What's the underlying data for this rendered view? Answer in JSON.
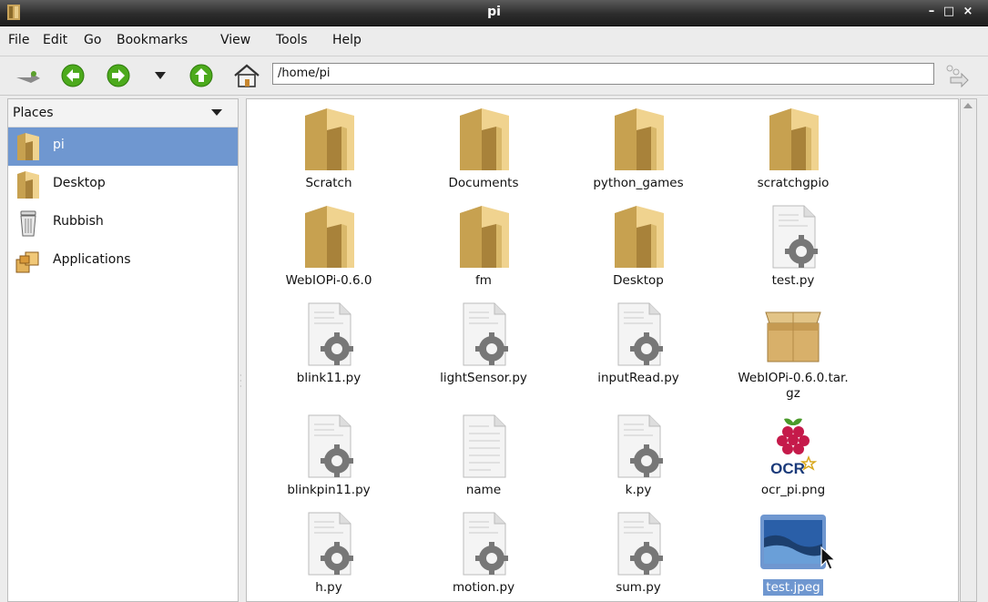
{
  "window": {
    "title": "pi",
    "minimize": "–",
    "maximize": "□",
    "close": "×"
  },
  "menu": [
    "File",
    "Edit",
    "Go",
    "Bookmarks",
    "View",
    "Tools",
    "Help"
  ],
  "toolbar": {
    "icons": [
      "new-tab-icon",
      "back-icon",
      "forward-icon",
      "history-dropdown-icon",
      "up-icon",
      "home-icon",
      "go-icon"
    ],
    "path": "/home/pi"
  },
  "sidebar": {
    "title": "Places",
    "items": [
      {
        "label": "pi",
        "icon": "home-folder-icon",
        "selected": true
      },
      {
        "label": "Desktop",
        "icon": "desktop-folder-icon",
        "selected": false
      },
      {
        "label": "Rubbish",
        "icon": "trash-icon",
        "selected": false
      },
      {
        "label": "Applications",
        "icon": "applications-icon",
        "selected": false
      }
    ]
  },
  "files": [
    {
      "name": "Scratch",
      "type": "folder"
    },
    {
      "name": "Documents",
      "type": "folder"
    },
    {
      "name": "python_games",
      "type": "folder"
    },
    {
      "name": "scratchgpio",
      "type": "folder"
    },
    {
      "name": "WebIOPi-0.6.0",
      "type": "folder"
    },
    {
      "name": "fm",
      "type": "folder"
    },
    {
      "name": "Desktop",
      "type": "folder"
    },
    {
      "name": "test.py",
      "type": "script"
    },
    {
      "name": "blink11.py",
      "type": "script"
    },
    {
      "name": "lightSensor.py",
      "type": "script"
    },
    {
      "name": "inputRead.py",
      "type": "script"
    },
    {
      "name": "WebIOPi-0.6.0.tar.\ngz",
      "type": "archive"
    },
    {
      "name": "blinkpin11.py",
      "type": "script"
    },
    {
      "name": "name",
      "type": "text"
    },
    {
      "name": "k.py",
      "type": "script"
    },
    {
      "name": "ocr_pi.png",
      "type": "logo-image",
      "logo_text": "OCR"
    },
    {
      "name": "h.py",
      "type": "script"
    },
    {
      "name": "motion.py",
      "type": "script"
    },
    {
      "name": "sum.py",
      "type": "script"
    },
    {
      "name": "test.jpeg",
      "type": "photo",
      "selected": true
    }
  ]
}
